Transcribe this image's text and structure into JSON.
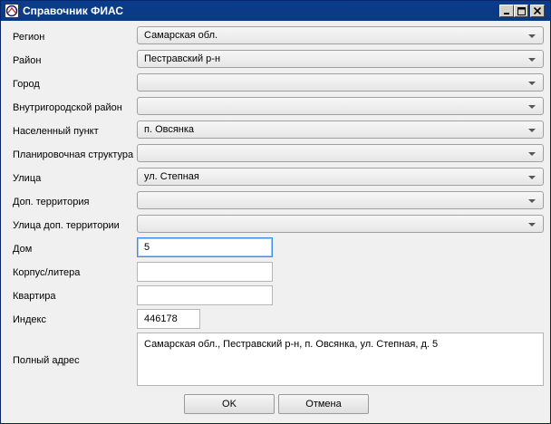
{
  "window": {
    "title": "Справочник ФИАС",
    "icon": "fias-app-icon",
    "controls": [
      "minimize",
      "maximize",
      "close"
    ]
  },
  "fields": {
    "region": {
      "label": "Регион",
      "value": "Самарская обл."
    },
    "district": {
      "label": "Район",
      "value": "Пестравский р-н"
    },
    "city": {
      "label": "Город",
      "value": ""
    },
    "intracity_district": {
      "label": "Внутригородской район",
      "value": ""
    },
    "locality": {
      "label": "Населенный пункт",
      "value": "п. Овсянка"
    },
    "planning_structure": {
      "label": "Планировочная структура",
      "value": ""
    },
    "street": {
      "label": "Улица",
      "value": "ул. Степная"
    },
    "add_territory": {
      "label": "Доп. территория",
      "value": ""
    },
    "add_territory_street": {
      "label": "Улица доп. территории",
      "value": ""
    },
    "house": {
      "label": "Дом",
      "value": "5"
    },
    "building": {
      "label": "Корпус/литера",
      "value": ""
    },
    "apartment": {
      "label": "Квартира",
      "value": ""
    },
    "index": {
      "label": "Индекс",
      "value": "446178"
    },
    "full_address": {
      "label": "Полный адрес",
      "value": "Самарская обл., Пестравский р-н, п. Овсянка, ул. Степная, д. 5"
    }
  },
  "buttons": {
    "ok": "OK",
    "cancel": "Отмена"
  }
}
